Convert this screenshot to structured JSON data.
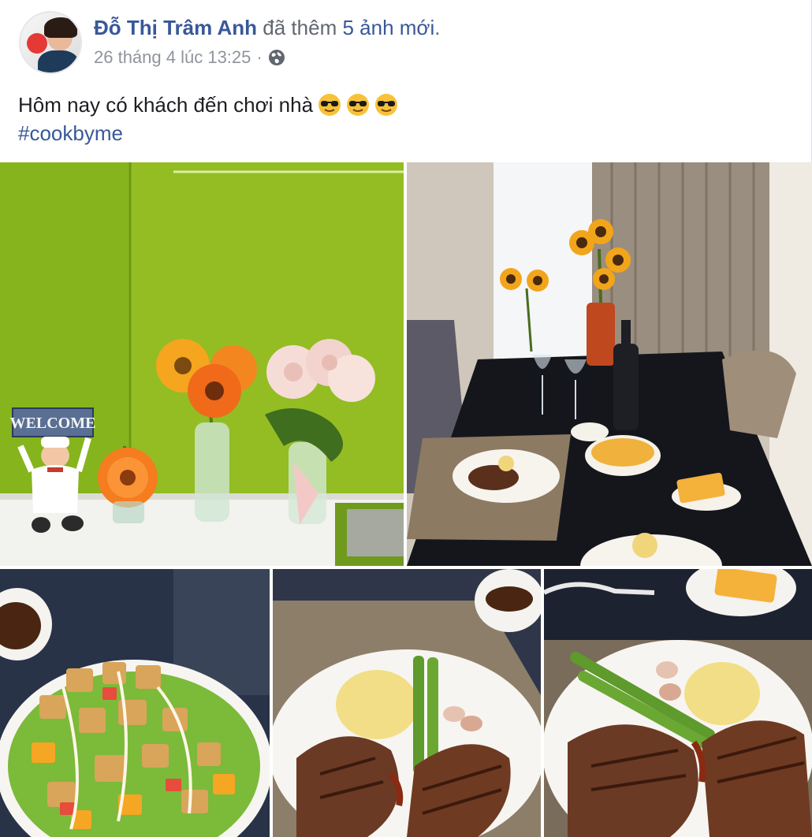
{
  "post": {
    "author": "Đỗ Thị Trâm Anh",
    "action": "đã thêm",
    "photo_count_link": "5 ảnh mới",
    "period": ".",
    "timestamp": "26 tháng 4 lúc 13:25",
    "separator": "·",
    "privacy_icon": "globe-icon",
    "text": "Hôm nay có khách đến chơi nhà",
    "emojis": [
      "sunglasses-emoji",
      "sunglasses-emoji",
      "sunglasses-emoji"
    ],
    "hashtag": "#cookbyme"
  },
  "photos": {
    "photo1": {
      "sign_text": "WELCOME"
    }
  }
}
